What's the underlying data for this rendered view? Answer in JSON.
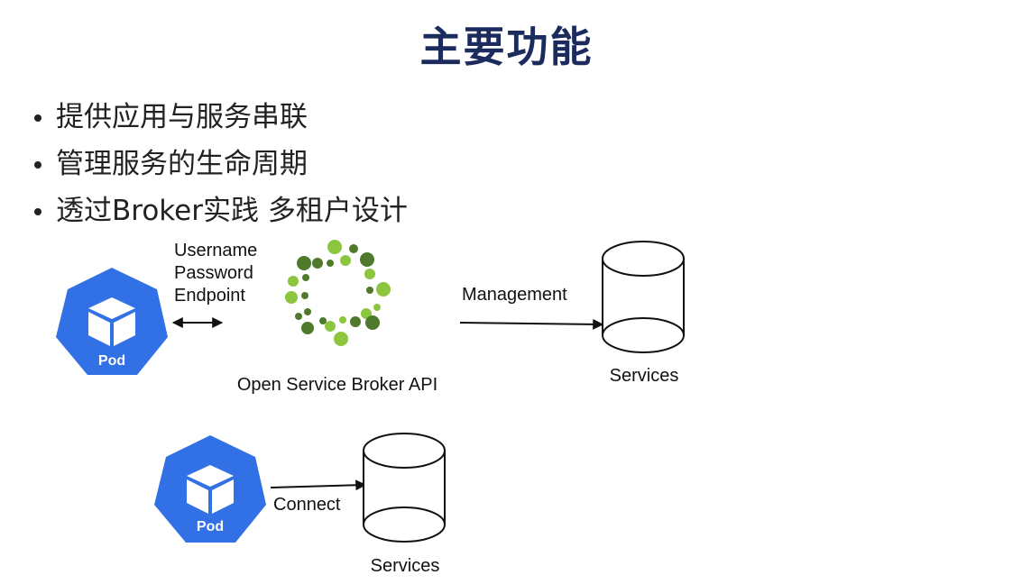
{
  "slide": {
    "title": "主要功能",
    "bullets": [
      "提供应用与服务串联",
      "管理服务的生命周期",
      "透过Broker实践 多租户设计"
    ]
  },
  "diagram": {
    "credentials": [
      "Username",
      "Password",
      "Endpoint"
    ],
    "pod_label": "Pod",
    "broker_label": "Open Service Broker API",
    "management_label": "Management",
    "connect_label": "Connect",
    "services_label": "Services"
  },
  "colors": {
    "title": "#1c2b5e",
    "pod_blue": "#3270e6",
    "broker_dark_green": "#4f7a2c",
    "broker_light_green": "#8cc63f"
  }
}
